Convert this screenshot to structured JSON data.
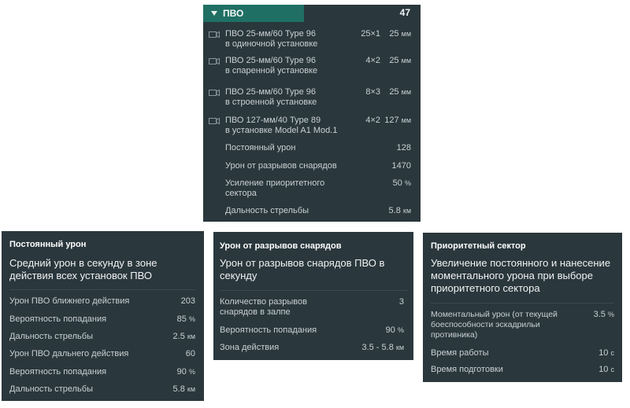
{
  "main": {
    "title": "ПВО",
    "count": "47",
    "mounts": [
      {
        "name": "ПВО 25-мм/60 Type 96",
        "sub": "в одиночной установке",
        "config": "25×1",
        "caliber": "25",
        "unit": "мм",
        "icon": "camera-icon"
      },
      {
        "name": "ПВО 25-мм/60 Type 96",
        "sub": "в спаренной установке",
        "config": "4×2",
        "caliber": "25",
        "unit": "мм",
        "icon": "camera-icon"
      },
      {
        "name": "ПВО 25-мм/60 Type 96",
        "sub": "в строенной установке",
        "config": "8×3",
        "caliber": "25",
        "unit": "мм",
        "icon": "camera-icon"
      },
      {
        "name": "ПВО 127-мм/40 Type 89",
        "sub": "в установке Model A1 Mod.1",
        "config": "4×2",
        "caliber": "127",
        "unit": "мм",
        "icon": "camera-icon"
      }
    ],
    "stats": [
      {
        "label": "Постоянный урон",
        "value": "128",
        "unit": ""
      },
      {
        "label": "Урон от разрывов снарядов",
        "value": "1470",
        "unit": ""
      },
      {
        "label": "Усиление приоритетного сектора",
        "value": "50",
        "unit": "%"
      },
      {
        "label": "Дальность стрельбы",
        "value": "5.8",
        "unit": "км"
      }
    ],
    "colors": {
      "panel": "#2a373c",
      "header_accent": "#1f6f64"
    }
  },
  "tooltips": [
    {
      "title": "Постоянный урон",
      "desc": "Средний урон в секунду в зоне действия всех установок ПВО",
      "rows": [
        {
          "label": "Урон ПВО ближнего действия",
          "value": "203",
          "unit": ""
        },
        {
          "label": "Вероятность попадания",
          "value": "85",
          "unit": "%"
        },
        {
          "label": "Дальность стрельбы",
          "value": "2.5",
          "unit": "км"
        },
        {
          "label": "Урон ПВО дальнего действия",
          "value": "60",
          "unit": ""
        },
        {
          "label": "Вероятность попадания",
          "value": "90",
          "unit": "%"
        },
        {
          "label": "Дальность стрельбы",
          "value": "5.8",
          "unit": "км"
        }
      ]
    },
    {
      "title": "Урон от разрывов снарядов",
      "desc": "Урон от разрывов снарядов ПВО в секунду",
      "rows": [
        {
          "label": "Количество разрывов снарядов в залпе",
          "value": "3",
          "unit": ""
        },
        {
          "label": "Вероятность попадания",
          "value": "90",
          "unit": "%"
        },
        {
          "label": "Зона действия",
          "value": "3.5 - 5.8",
          "unit": "км"
        }
      ]
    },
    {
      "title": "Приоритетный сектор",
      "desc": "Увеличение постоянного и нанесение моментального урона при выборе приоритетного сектора",
      "rows": [
        {
          "label": "Моментальный урон (от текущей боеспособности эскадрильи противника)",
          "value": "3.5",
          "unit": "%"
        },
        {
          "label": "Время работы",
          "value": "10",
          "unit": "с"
        },
        {
          "label": "Время подготовки",
          "value": "10",
          "unit": "с"
        }
      ]
    }
  ]
}
